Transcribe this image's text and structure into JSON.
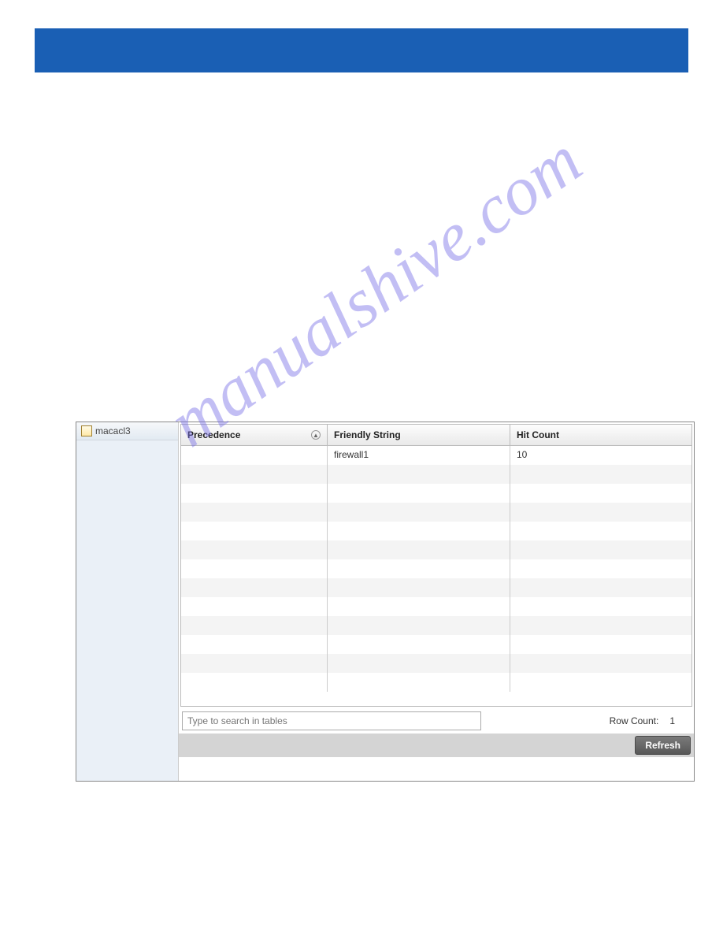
{
  "watermark": "manualshive.com",
  "sidebar": {
    "items": [
      {
        "label": "macacl3"
      }
    ]
  },
  "grid": {
    "headers": {
      "precedence": "Precedence",
      "friendly": "Friendly String",
      "hit": "Hit Count"
    },
    "rows": [
      {
        "precedence": "",
        "friendly": "firewall1",
        "hit": "10"
      }
    ],
    "search_placeholder": "Type to search in tables",
    "row_count_label": "Row Count:",
    "row_count_value": "1"
  },
  "buttons": {
    "refresh": "Refresh"
  }
}
